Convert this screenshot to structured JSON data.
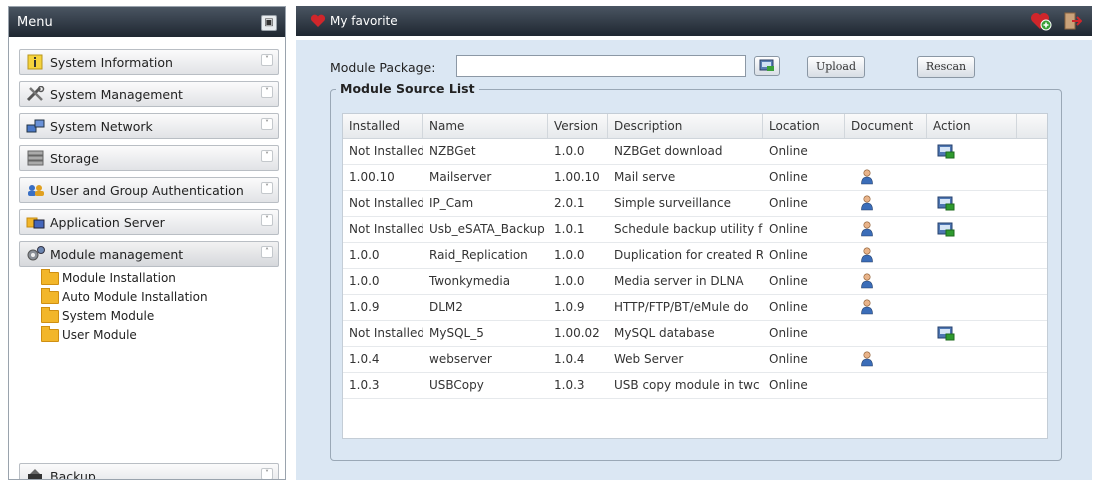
{
  "menu": {
    "title": "Menu",
    "collapse_icon": "collapse-icon",
    "categories": [
      {
        "label": "System Information",
        "icon": "info-icon"
      },
      {
        "label": "System Management",
        "icon": "tools-icon"
      },
      {
        "label": "System Network",
        "icon": "network-icon"
      },
      {
        "label": "Storage",
        "icon": "storage-icon"
      },
      {
        "label": "User and Group Authentication",
        "icon": "users-icon"
      },
      {
        "label": "Application Server",
        "icon": "app-server-icon"
      },
      {
        "label": "Module management",
        "icon": "gears-icon"
      },
      {
        "label": "Backup",
        "icon": "backup-icon"
      }
    ],
    "module_items": [
      {
        "label": "Module Installation"
      },
      {
        "label": "Auto Module Installation"
      },
      {
        "label": "System Module"
      },
      {
        "label": "User Module"
      }
    ]
  },
  "topbar": {
    "favorite_label": "My favorite",
    "icons": [
      "heart-icon",
      "add-favorite-icon",
      "logout-icon"
    ]
  },
  "module_package": {
    "label": "Module Package:",
    "value": "",
    "browse_icon": "browse-icon",
    "upload_label": "Upload",
    "rescan_label": "Rescan"
  },
  "source_list": {
    "legend": "Module Source List",
    "columns": [
      "Installed",
      "Name",
      "Version",
      "Description",
      "Location",
      "Document",
      "Action"
    ],
    "rows": [
      {
        "installed": "Not Installed",
        "name": "NZBGet",
        "version": "1.0.0",
        "description": "NZBGet download",
        "location": "Online",
        "document": false,
        "action": true
      },
      {
        "installed": "1.00.10",
        "name": "Mailserver",
        "version": "1.00.10",
        "description": "Mail serve",
        "location": "Online",
        "document": true,
        "action": false
      },
      {
        "installed": "Not Installed",
        "name": "IP_Cam",
        "version": "2.0.1",
        "description": "Simple surveillance",
        "location": "Online",
        "document": true,
        "action": true
      },
      {
        "installed": "Not Installed",
        "name": "Usb_eSATA_Backup",
        "version": "1.0.1",
        "description": "Schedule backup utility f",
        "location": "Online",
        "document": true,
        "action": true
      },
      {
        "installed": "1.0.0",
        "name": "Raid_Replication",
        "version": "1.0.0",
        "description": "Duplication for created R",
        "location": "Online",
        "document": true,
        "action": false
      },
      {
        "installed": "1.0.0",
        "name": "Twonkymedia",
        "version": "1.0.0",
        "description": "Media server in DLNA",
        "location": "Online",
        "document": true,
        "action": false
      },
      {
        "installed": "1.0.9",
        "name": "DLM2",
        "version": "1.0.9",
        "description": "HTTP/FTP/BT/eMule do",
        "location": "Online",
        "document": true,
        "action": false
      },
      {
        "installed": "Not Installed",
        "name": "MySQL_5",
        "version": "1.00.02",
        "description": "MySQL database",
        "location": "Online",
        "document": false,
        "action": true
      },
      {
        "installed": "1.0.4",
        "name": "webserver",
        "version": "1.0.4",
        "description": "Web Server",
        "location": "Online",
        "document": true,
        "action": false
      },
      {
        "installed": "1.0.3",
        "name": "USBCopy",
        "version": "1.0.3",
        "description": "USB copy module in twc",
        "location": "Online",
        "document": false,
        "action": false
      }
    ],
    "document_icon": "user-doc-icon",
    "action_icon": "install-icon"
  }
}
